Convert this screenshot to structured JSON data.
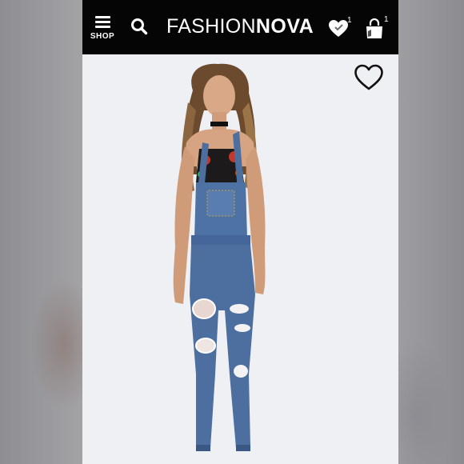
{
  "header": {
    "shop_label": "SHOP",
    "brand_light": "FASHION",
    "brand_bold": "NOVA",
    "wishlist_count": "1",
    "cart_count": "1"
  },
  "icons": {
    "menu": "hamburger-icon",
    "search": "search-icon",
    "wishlist": "heart-icon",
    "cart": "shopping-bag-icon",
    "favorite": "heart-outline-icon"
  },
  "colors": {
    "header_bg": "#050505",
    "page_bg": "#eff0f4",
    "denim": "#4d6fa0"
  }
}
